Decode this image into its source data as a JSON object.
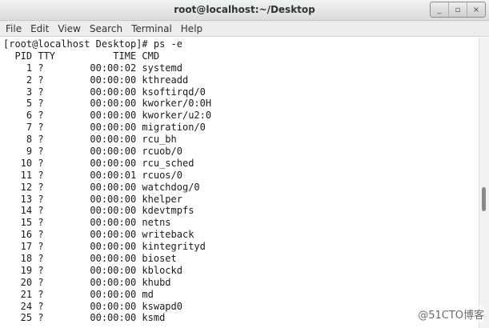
{
  "window": {
    "title": "root@localhost:~/Desktop",
    "buttons": {
      "minimize": "_",
      "maximize": "▫",
      "close": "×"
    }
  },
  "menu": [
    "File",
    "Edit",
    "View",
    "Search",
    "Terminal",
    "Help"
  ],
  "terminal": {
    "lines": [
      "[root@localhost Desktop]# ps -e",
      "  PID TTY          TIME CMD",
      "    1 ?        00:00:02 systemd",
      "    2 ?        00:00:00 kthreadd",
      "    3 ?        00:00:00 ksoftirqd/0",
      "    5 ?        00:00:00 kworker/0:0H",
      "    6 ?        00:00:00 kworker/u2:0",
      "    7 ?        00:00:00 migration/0",
      "    8 ?        00:00:00 rcu_bh",
      "    9 ?        00:00:00 rcuob/0",
      "   10 ?        00:00:00 rcu_sched",
      "   11 ?        00:00:01 rcuos/0",
      "   12 ?        00:00:00 watchdog/0",
      "   13 ?        00:00:00 khelper",
      "   14 ?        00:00:00 kdevtmpfs",
      "   15 ?        00:00:00 netns",
      "   16 ?        00:00:00 writeback",
      "   17 ?        00:00:00 kintegrityd",
      "   18 ?        00:00:00 bioset",
      "   19 ?        00:00:00 kblockd",
      "   20 ?        00:00:00 khubd",
      "   21 ?        00:00:00 md",
      "   24 ?        00:00:00 kswapd0",
      "   25 ?        00:00:00 ksmd"
    ]
  },
  "watermark": "@51CTO博客"
}
